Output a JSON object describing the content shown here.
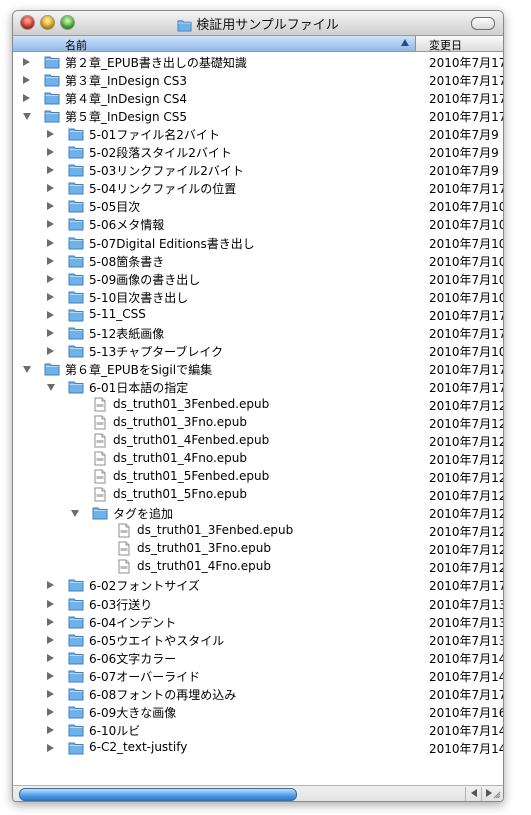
{
  "window": {
    "title": "検証用サンプルファイル"
  },
  "columns": {
    "name": "名前",
    "date": "変更日"
  },
  "colors": {
    "folder": "#6fb2ea",
    "selection_header": "#8fb8ec",
    "scroll_thumb": "#4f9ae6"
  },
  "rows": [
    {
      "depth": 0,
      "kind": "folder",
      "disclosure": "closed",
      "name": "第２章_EPUB書き出しの基礎知識",
      "date": "2010年7月17"
    },
    {
      "depth": 0,
      "kind": "folder",
      "disclosure": "closed",
      "name": "第３章_InDesign CS3",
      "date": "2010年7月17"
    },
    {
      "depth": 0,
      "kind": "folder",
      "disclosure": "closed",
      "name": "第４章_InDesign CS4",
      "date": "2010年7月17"
    },
    {
      "depth": 0,
      "kind": "folder",
      "disclosure": "open",
      "name": "第５章_InDesign CS5",
      "date": "2010年7月17"
    },
    {
      "depth": 1,
      "kind": "folder",
      "disclosure": "closed",
      "name": "5-01ファイル名2バイト",
      "date": "2010年7月9"
    },
    {
      "depth": 1,
      "kind": "folder",
      "disclosure": "closed",
      "name": "5-02段落スタイル2バイト",
      "date": "2010年7月9"
    },
    {
      "depth": 1,
      "kind": "folder",
      "disclosure": "closed",
      "name": "5-03リンクファイル2バイト",
      "date": "2010年7月9"
    },
    {
      "depth": 1,
      "kind": "folder",
      "disclosure": "closed",
      "name": "5-04リンクファイルの位置",
      "date": "2010年7月17"
    },
    {
      "depth": 1,
      "kind": "folder",
      "disclosure": "closed",
      "name": "5-05目次",
      "date": "2010年7月10"
    },
    {
      "depth": 1,
      "kind": "folder",
      "disclosure": "closed",
      "name": "5-06メタ情報",
      "date": "2010年7月10"
    },
    {
      "depth": 1,
      "kind": "folder",
      "disclosure": "closed",
      "name": "5-07Digital Editions書き出し",
      "date": "2010年7月10"
    },
    {
      "depth": 1,
      "kind": "folder",
      "disclosure": "closed",
      "name": "5-08箇条書き",
      "date": "2010年7月10"
    },
    {
      "depth": 1,
      "kind": "folder",
      "disclosure": "closed",
      "name": "5-09画像の書き出し",
      "date": "2010年7月10"
    },
    {
      "depth": 1,
      "kind": "folder",
      "disclosure": "closed",
      "name": "5-10目次書き出し",
      "date": "2010年7月10"
    },
    {
      "depth": 1,
      "kind": "folder",
      "disclosure": "closed",
      "name": "5-11_CSS",
      "date": "2010年7月17"
    },
    {
      "depth": 1,
      "kind": "folder",
      "disclosure": "closed",
      "name": "5-12表紙画像",
      "date": "2010年7月17"
    },
    {
      "depth": 1,
      "kind": "folder",
      "disclosure": "closed",
      "name": "5-13チャプターブレイク",
      "date": "2010年7月10"
    },
    {
      "depth": 0,
      "kind": "folder",
      "disclosure": "open",
      "name": "第６章_EPUBをSigilで編集",
      "date": "2010年7月17"
    },
    {
      "depth": 1,
      "kind": "folder",
      "disclosure": "open",
      "name": "6-01日本語の指定",
      "date": "2010年7月17"
    },
    {
      "depth": 2,
      "kind": "file",
      "disclosure": "none",
      "name": "ds_truth01_3Fenbed.epub",
      "date": "2010年7月12"
    },
    {
      "depth": 2,
      "kind": "file",
      "disclosure": "none",
      "name": "ds_truth01_3Fno.epub",
      "date": "2010年7月12"
    },
    {
      "depth": 2,
      "kind": "file",
      "disclosure": "none",
      "name": "ds_truth01_4Fenbed.epub",
      "date": "2010年7月12"
    },
    {
      "depth": 2,
      "kind": "file",
      "disclosure": "none",
      "name": "ds_truth01_4Fno.epub",
      "date": "2010年7月12"
    },
    {
      "depth": 2,
      "kind": "file",
      "disclosure": "none",
      "name": "ds_truth01_5Fenbed.epub",
      "date": "2010年7月12"
    },
    {
      "depth": 2,
      "kind": "file",
      "disclosure": "none",
      "name": "ds_truth01_5Fno.epub",
      "date": "2010年7月12"
    },
    {
      "depth": 2,
      "kind": "folder",
      "disclosure": "open",
      "name": "タグを追加",
      "date": "2010年7月12"
    },
    {
      "depth": 3,
      "kind": "file",
      "disclosure": "none",
      "name": "ds_truth01_3Fenbed.epub",
      "date": "2010年7月12"
    },
    {
      "depth": 3,
      "kind": "file",
      "disclosure": "none",
      "name": "ds_truth01_3Fno.epub",
      "date": "2010年7月12"
    },
    {
      "depth": 3,
      "kind": "file",
      "disclosure": "none",
      "name": "ds_truth01_4Fno.epub",
      "date": "2010年7月12"
    },
    {
      "depth": 1,
      "kind": "folder",
      "disclosure": "closed",
      "name": "6-02フォントサイズ",
      "date": "2010年7月17"
    },
    {
      "depth": 1,
      "kind": "folder",
      "disclosure": "closed",
      "name": "6-03行送り",
      "date": "2010年7月13"
    },
    {
      "depth": 1,
      "kind": "folder",
      "disclosure": "closed",
      "name": "6-04インデント",
      "date": "2010年7月13"
    },
    {
      "depth": 1,
      "kind": "folder",
      "disclosure": "closed",
      "name": "6-05ウエイトやスタイル",
      "date": "2010年7月13"
    },
    {
      "depth": 1,
      "kind": "folder",
      "disclosure": "closed",
      "name": "6-06文字カラー",
      "date": "2010年7月14"
    },
    {
      "depth": 1,
      "kind": "folder",
      "disclosure": "closed",
      "name": "6-07オーバーライド",
      "date": "2010年7月14"
    },
    {
      "depth": 1,
      "kind": "folder",
      "disclosure": "closed",
      "name": "6-08フォントの再埋め込み",
      "date": "2010年7月17"
    },
    {
      "depth": 1,
      "kind": "folder",
      "disclosure": "closed",
      "name": "6-09大きな画像",
      "date": "2010年7月16"
    },
    {
      "depth": 1,
      "kind": "folder",
      "disclosure": "closed",
      "name": "6-10ルビ",
      "date": "2010年7月14"
    },
    {
      "depth": 1,
      "kind": "folder",
      "disclosure": "closed",
      "name": "6-C2_text-justify",
      "date": "2010年7月14"
    }
  ]
}
